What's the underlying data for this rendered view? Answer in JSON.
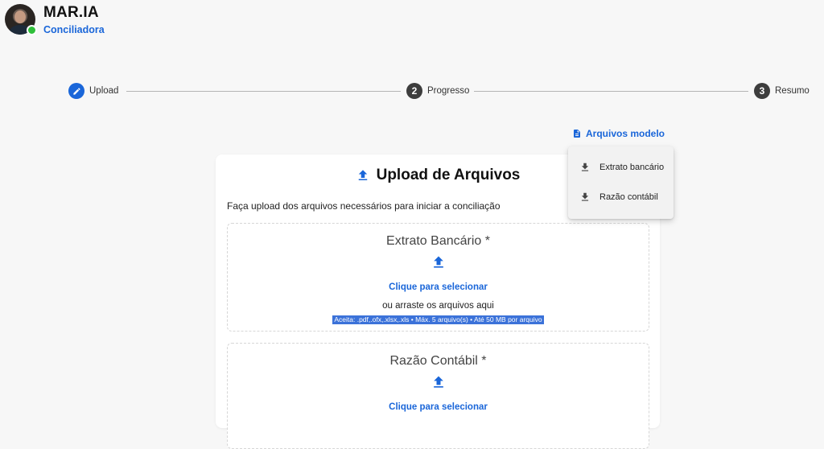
{
  "app": {
    "title": "MAR.IA",
    "subtitle": "Conciliadora",
    "avatar_icon": "user-avatar",
    "status_color": "#2fbf3a"
  },
  "stepper": {
    "steps": [
      {
        "number": "",
        "label": "Upload",
        "icon": "pencil-icon",
        "state": "active"
      },
      {
        "number": "2",
        "label": "Progresso",
        "state": "idle"
      },
      {
        "number": "3",
        "label": "Resumo",
        "state": "idle"
      }
    ]
  },
  "templates": {
    "link_label": "Arquivos modelo",
    "icon": "document-icon",
    "items": [
      {
        "label": "Extrato bancário",
        "icon": "download-icon"
      },
      {
        "label": "Razão contábil",
        "icon": "download-icon"
      }
    ]
  },
  "upload": {
    "title": "Upload de Arquivos",
    "icon": "upload-icon",
    "description": "Faça upload dos arquivos necessários para iniciar a conciliação",
    "zones": [
      {
        "title": "Extrato Bancário *",
        "select_label": "Clique para selecionar",
        "drag_label": "ou arraste os arquivos aqui",
        "accept_label": "Aceita: .pdf,.ofx,.xlsx,.xls • Máx. 5 arquivo(s) • Até 50 MB por arquivo"
      },
      {
        "title": "Razão Contábil *",
        "select_label": "Clique para selecionar"
      }
    ]
  },
  "colors": {
    "accent": "#1a66d9",
    "step_idle": "#3d3d3d",
    "background": "#f7f7f7"
  }
}
